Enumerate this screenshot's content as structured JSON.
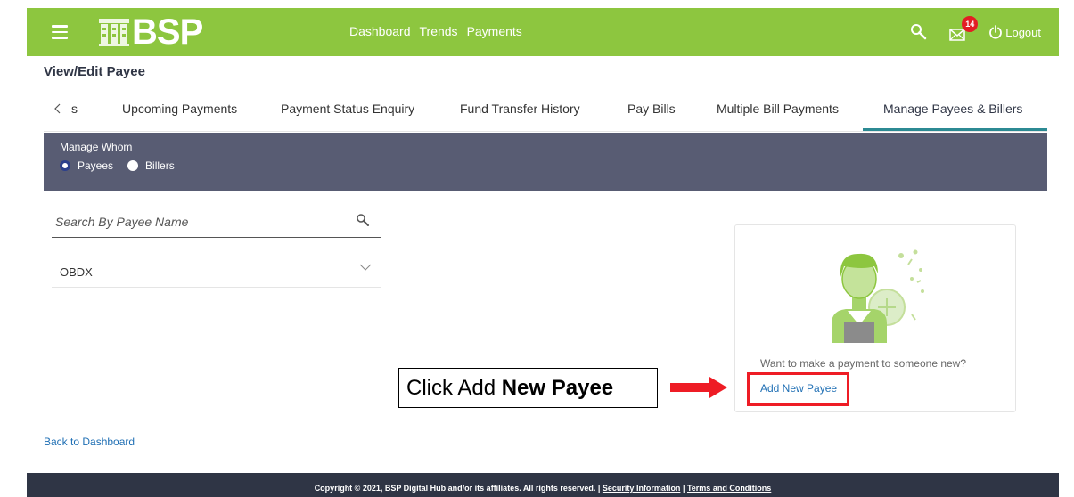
{
  "header": {
    "brand": "BSP",
    "nav": [
      "Dashboard",
      "Trends",
      "Payments"
    ],
    "notification_count": "14",
    "logout_label": "Logout",
    "bar_color": "#8dc63f"
  },
  "page_title": "View/Edit Payee",
  "tabs": {
    "back_label": "s",
    "items": [
      "Upcoming Payments",
      "Payment Status Enquiry",
      "Fund Transfer History",
      "Pay Bills",
      "Multiple Bill Payments",
      "Manage Payees & Billers"
    ],
    "active": "Manage Payees & Billers"
  },
  "manage_whom": {
    "label": "Manage Whom",
    "options": [
      "Payees",
      "Billers"
    ],
    "selected": "Payees"
  },
  "search": {
    "placeholder": "Search By Payee Name"
  },
  "payees": [
    "OBDX"
  ],
  "card": {
    "prompt": "Want to make a payment to someone new?",
    "link": "Add New Payee"
  },
  "callout": {
    "prefix": "Click Add ",
    "bold": "New Payee"
  },
  "back_link": "Back to Dashboard",
  "footer": {
    "copyright": "Copyright © 2021, BSP Digital Hub and/or its affiliates. All rights reserved. | ",
    "security": "Security Information",
    "separator": " | ",
    "terms": "Terms and Conditions"
  }
}
